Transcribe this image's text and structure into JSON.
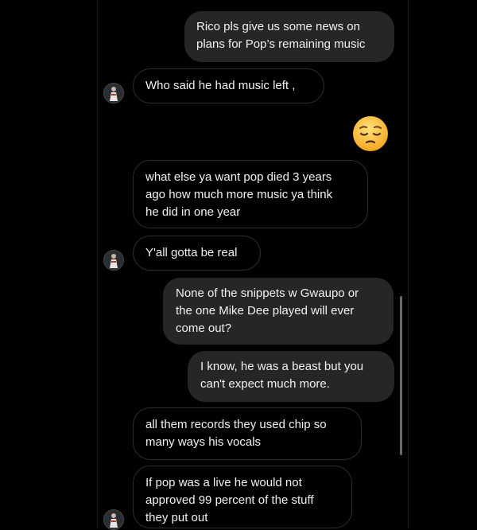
{
  "messages": [
    {
      "from": "me",
      "lines": [
        "Rico pls give us some news on",
        "plans for Pop’s remaining music"
      ]
    },
    {
      "from": "them",
      "lines": [
        "Who said he had music left ,"
      ]
    },
    {
      "from": "me",
      "emoji": "pensive-face"
    },
    {
      "from": "them",
      "lines": [
        "what else ya want pop died 3 years",
        "ago how much more music ya think",
        "he did in one year"
      ]
    },
    {
      "from": "them",
      "lines": [
        "Y'all gotta be real"
      ]
    },
    {
      "from": "me",
      "lines": [
        "None of the snippets w Gwaupo or",
        "the one Mike Dee played will ever",
        "come out?"
      ]
    },
    {
      "from": "me",
      "lines": [
        "I know, he was a beast but you",
        "can't expect much more."
      ]
    },
    {
      "from": "them",
      "lines": [
        "all them records they used chip so",
        "many ways his vocals"
      ]
    },
    {
      "from": "them",
      "lines": [
        "If pop was a live he would not",
        "approved 99 percent of the stuff",
        "they put out"
      ]
    }
  ],
  "colors": {
    "background": "#000000",
    "outgoing_bubble": "#262626",
    "incoming_border": "#2f2f2f",
    "text": "#f2f2f2"
  },
  "icons": {
    "avatar": "profile-avatar-icon",
    "emoji": "pensive-face-emoji"
  }
}
